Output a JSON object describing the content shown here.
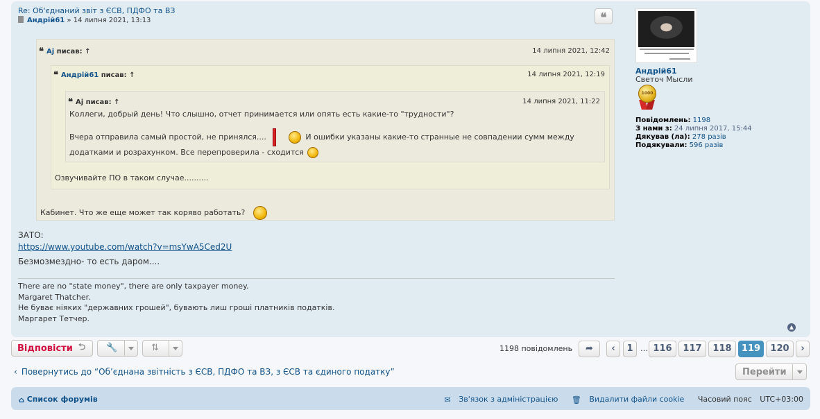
{
  "post": {
    "title": "Re: Об'єднаний звіт з ЄСВ, ПДФО та ВЗ",
    "author": "Андрій61",
    "date_sep": "»",
    "date": "14 липня 2021, 13:13",
    "quote_button": "❝",
    "quote1": {
      "author": "Aj",
      "says": "писав:",
      "arrow": "↑",
      "date": "14 липня 2021, 12:42",
      "text": "Кабинет. Что же еще может так коряво работать?"
    },
    "quote2": {
      "author": "Андрій61",
      "says": "писав:",
      "arrow": "↑",
      "date": "14 липня 2021, 12:19",
      "text": "Озвучивайте ПО в таком случае.........."
    },
    "quote3": {
      "author": "Aj",
      "says": "писав:",
      "arrow": "↑",
      "date": "14 липня 2021, 11:22",
      "line1": "Коллеги, добрый день! Что слышно, отчет принимается или опять есть какие-то \"трудности\"?",
      "line2a": "Вчера отправила самый простой, не принялся....",
      "line2b": "И ошибки указаны какие-то странные не совпадении сумм между",
      "line3": "додатками и розрахунком. Все перепроверила - сходится"
    },
    "zato": "ЗАТО:",
    "link": "https://www.youtube.com/watch?v=msYwA5Ced2U",
    "after_link": "Безмозмездно- то есть даром....",
    "signature": [
      "There are no \"state money\", there are only taxpayer money.",
      "Margaret Thatcher.",
      "Не буває ніяких \"державних грошей\", бувають лиш гроші платників податків.",
      "Маргарет Тетчер."
    ]
  },
  "profile": {
    "name": "Андрій61",
    "rank": "Светоч Мысли",
    "rank_badge": "1000",
    "stats": [
      {
        "label": "Повідомлень:",
        "value": "1198"
      },
      {
        "label": "З нами з:",
        "value": "24 липня 2017, 15:44"
      },
      {
        "label": "Дякував (ла):",
        "value": "278 разів"
      },
      {
        "label": "Подякували:",
        "value": "596 разів"
      }
    ]
  },
  "actions": {
    "reply_label": "Відповісти",
    "post_count": "1198 повідомлень",
    "pages": [
      "1",
      "116",
      "117",
      "118",
      "119",
      "120"
    ],
    "active_page": "119",
    "dots": "…",
    "back_link": "Повернутись до “Об’єднана звітність з ЄСВ, ПДФО та ВЗ, з ЄСВ та єдиного податку”",
    "jump_label": "Перейти"
  },
  "footer": {
    "home": "Список форумів",
    "contact": "Зв'язок з адміністрацією",
    "delete_cookies": "Видалити файли cookie",
    "timezone": "Часовий пояс",
    "tz_value": "UTC+03:00"
  },
  "colors": {
    "post_bg": "#e1ebf2",
    "link": "#105289",
    "reply": "#d31141",
    "active_page": "#4692bf",
    "footer_bg": "#cadceb"
  }
}
